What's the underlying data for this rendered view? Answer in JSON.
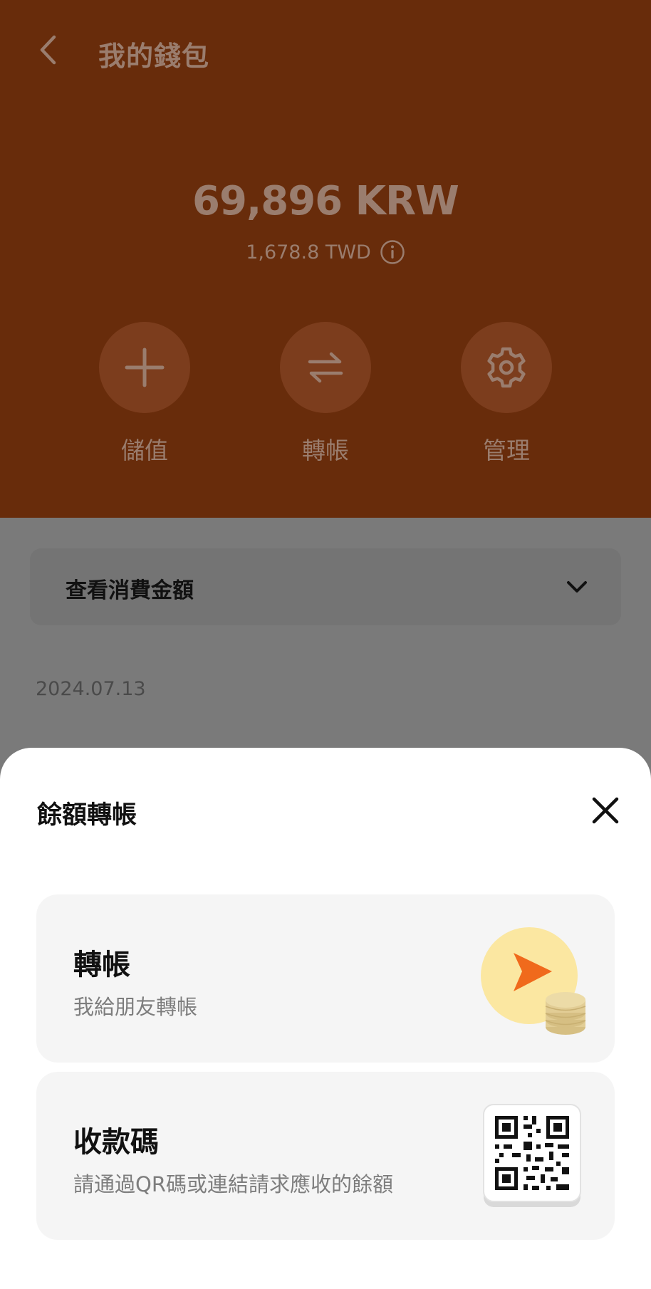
{
  "header": {
    "title": "我的錢包",
    "balance": "69,896 KRW",
    "balance_converted": "1,678.8 TWD"
  },
  "actions": [
    {
      "label": "儲值",
      "icon": "plus-icon"
    },
    {
      "label": "轉帳",
      "icon": "transfer-arrows-icon"
    },
    {
      "label": "管理",
      "icon": "gear-icon"
    }
  ],
  "spending": {
    "label": "查看消費金額"
  },
  "history": {
    "date": "2024.07.13"
  },
  "sheet": {
    "title": "餘額轉帳",
    "options": [
      {
        "title": "轉帳",
        "description": "我給朋友轉帳",
        "icon": "send-coins-icon"
      },
      {
        "title": "收款碼",
        "description": "請通過QR碼或連結請求應收的餘額",
        "icon": "qr-code-icon"
      }
    ]
  },
  "colors": {
    "header_bg": "#682c0b",
    "accent": "#f06a1c",
    "icon_circle": "#fbe7a1",
    "coin": "#e2cd95"
  }
}
